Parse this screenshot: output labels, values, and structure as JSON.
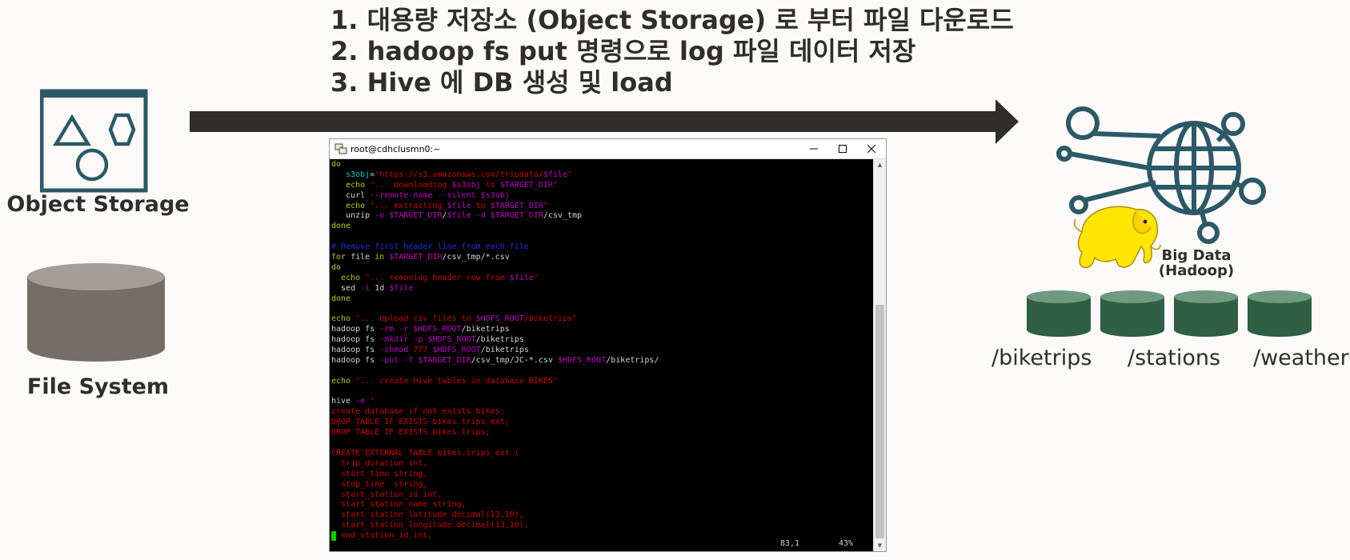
{
  "steps": [
    "1. 대용량 저장소 (Object Storage) 로 부터 파일 다운로드",
    "2. hadoop fs put 명령으로 log 파일 데이터 저장",
    "3. Hive 에 DB 생성 및 load"
  ],
  "left": {
    "object_storage_label": "Object Storage",
    "file_system_label": "File System"
  },
  "right": {
    "big_data_label_line1": "Big Data",
    "big_data_label_line2": "(Hadoop)",
    "paths": [
      "/biketrips",
      "/stations",
      "/weather"
    ]
  },
  "colors": {
    "text": "#312d2a",
    "arrow": "#312d2a",
    "teal": "#2c5967",
    "disk_green": "#2f5f44",
    "cylinder_gray": "#756d68",
    "hadoop_yellow": "#ffe600"
  },
  "icons": {
    "object_storage": "object-storage-icon",
    "file_system": "database-cylinder-icon",
    "big_data": "globe-network-icon",
    "hadoop": "hadoop-elephant-icon"
  },
  "terminal": {
    "title": "root@cdhclusmn0:~",
    "status_position": "83,1",
    "status_percent": "43%",
    "lines": [
      [
        {
          "c": "t-y",
          "t": "do"
        }
      ],
      [
        {
          "c": "t-w",
          "t": "   "
        },
        {
          "c": "t-c",
          "t": "s3obj"
        },
        {
          "c": "t-w",
          "t": "="
        },
        {
          "c": "t-r",
          "t": "\"https://s3.amazonaws.com/tripdata/"
        },
        {
          "c": "t-m",
          "t": "$file"
        },
        {
          "c": "t-r",
          "t": "\""
        }
      ],
      [
        {
          "c": "t-w",
          "t": "   "
        },
        {
          "c": "t-y",
          "t": "echo"
        },
        {
          "c": "t-w",
          "t": " "
        },
        {
          "c": "t-r",
          "t": "\"... downloading "
        },
        {
          "c": "t-m",
          "t": "$s3obj"
        },
        {
          "c": "t-r",
          "t": " to "
        },
        {
          "c": "t-m",
          "t": "$TARGET_DIR"
        },
        {
          "c": "t-r",
          "t": "\""
        }
      ],
      [
        {
          "c": "t-w",
          "t": "   curl "
        },
        {
          "c": "t-m",
          "t": "--remote-name --silent"
        },
        {
          "c": "t-w",
          "t": " "
        },
        {
          "c": "t-m",
          "t": "$s3obj"
        }
      ],
      [
        {
          "c": "t-w",
          "t": "   "
        },
        {
          "c": "t-y",
          "t": "echo"
        },
        {
          "c": "t-w",
          "t": " "
        },
        {
          "c": "t-r",
          "t": "\"... extracting "
        },
        {
          "c": "t-m",
          "t": "$file"
        },
        {
          "c": "t-r",
          "t": " to "
        },
        {
          "c": "t-m",
          "t": "$TARGET_DIR"
        },
        {
          "c": "t-r",
          "t": "\""
        }
      ],
      [
        {
          "c": "t-w",
          "t": "   unzip "
        },
        {
          "c": "t-m",
          "t": "-o"
        },
        {
          "c": "t-w",
          "t": " "
        },
        {
          "c": "t-m",
          "t": "$TARGET_DIR"
        },
        {
          "c": "t-w",
          "t": "/"
        },
        {
          "c": "t-m",
          "t": "$file"
        },
        {
          "c": "t-w",
          "t": " "
        },
        {
          "c": "t-m",
          "t": "-d"
        },
        {
          "c": "t-w",
          "t": " "
        },
        {
          "c": "t-m",
          "t": "$TARGET_DIR"
        },
        {
          "c": "t-w",
          "t": "/csv_tmp"
        }
      ],
      [
        {
          "c": "t-y",
          "t": "done"
        }
      ],
      [
        {
          "c": "t-w",
          "t": ""
        }
      ],
      [
        {
          "c": "t-b",
          "t": "# Remove first header line from each file"
        }
      ],
      [
        {
          "c": "t-y",
          "t": "for"
        },
        {
          "c": "t-w",
          "t": " file "
        },
        {
          "c": "t-y",
          "t": "in"
        },
        {
          "c": "t-w",
          "t": " "
        },
        {
          "c": "t-m",
          "t": "$TARGET_DIR"
        },
        {
          "c": "t-w",
          "t": "/csv_tmp/*.csv"
        }
      ],
      [
        {
          "c": "t-y",
          "t": "do"
        }
      ],
      [
        {
          "c": "t-w",
          "t": "  "
        },
        {
          "c": "t-y",
          "t": "echo"
        },
        {
          "c": "t-w",
          "t": " "
        },
        {
          "c": "t-r",
          "t": "\"... removing header row from "
        },
        {
          "c": "t-m",
          "t": "$file"
        },
        {
          "c": "t-r",
          "t": "\""
        }
      ],
      [
        {
          "c": "t-w",
          "t": "  sed "
        },
        {
          "c": "t-m",
          "t": "-i"
        },
        {
          "c": "t-w",
          "t": " 1d "
        },
        {
          "c": "t-m",
          "t": "$file"
        }
      ],
      [
        {
          "c": "t-y",
          "t": "done"
        }
      ],
      [
        {
          "c": "t-w",
          "t": ""
        }
      ],
      [
        {
          "c": "t-y",
          "t": "echo"
        },
        {
          "c": "t-w",
          "t": " "
        },
        {
          "c": "t-r",
          "t": "\"... Upload csv files to "
        },
        {
          "c": "t-m",
          "t": "$HDFS_ROOT"
        },
        {
          "c": "t-r",
          "t": "/biketrips\""
        }
      ],
      [
        {
          "c": "t-w",
          "t": "hadoop fs "
        },
        {
          "c": "t-m",
          "t": "-rm -r"
        },
        {
          "c": "t-w",
          "t": " "
        },
        {
          "c": "t-m",
          "t": "$HDFS_ROOT"
        },
        {
          "c": "t-w",
          "t": "/biketrips"
        }
      ],
      [
        {
          "c": "t-w",
          "t": "hadoop fs "
        },
        {
          "c": "t-m",
          "t": "-mkdir -p"
        },
        {
          "c": "t-w",
          "t": " "
        },
        {
          "c": "t-m",
          "t": "$HDFS_ROOT"
        },
        {
          "c": "t-w",
          "t": "/biketrips"
        }
      ],
      [
        {
          "c": "t-w",
          "t": "hadoop fs "
        },
        {
          "c": "t-m",
          "t": "-chmod"
        },
        {
          "c": "t-w",
          "t": " "
        },
        {
          "c": "t-r",
          "t": "777"
        },
        {
          "c": "t-w",
          "t": " "
        },
        {
          "c": "t-m",
          "t": "$HDFS_ROOT"
        },
        {
          "c": "t-w",
          "t": "/biketrips"
        }
      ],
      [
        {
          "c": "t-w",
          "t": "hadoop fs "
        },
        {
          "c": "t-m",
          "t": "-put -f"
        },
        {
          "c": "t-w",
          "t": " "
        },
        {
          "c": "t-m",
          "t": "$TARGET_DIR"
        },
        {
          "c": "t-w",
          "t": "/csv_tmp/JC-*.csv "
        },
        {
          "c": "t-m",
          "t": "$HDFS_ROOT"
        },
        {
          "c": "t-w",
          "t": "/biketrips/"
        }
      ],
      [
        {
          "c": "t-w",
          "t": ""
        }
      ],
      [
        {
          "c": "t-y",
          "t": "echo"
        },
        {
          "c": "t-w",
          "t": " "
        },
        {
          "c": "t-r",
          "t": "\"... create Hive tables in database BIKES\""
        }
      ],
      [
        {
          "c": "t-w",
          "t": ""
        }
      ],
      [
        {
          "c": "t-w",
          "t": "hive "
        },
        {
          "c": "t-m",
          "t": "-e"
        },
        {
          "c": "t-w",
          "t": " "
        },
        {
          "c": "t-r",
          "t": "\""
        }
      ],
      [
        {
          "c": "t-r",
          "t": "create database if not exists bikes;"
        }
      ],
      [
        {
          "c": "t-r",
          "t": "DROP TABLE IF EXISTS bikes.trips_ext;"
        }
      ],
      [
        {
          "c": "t-r",
          "t": "DROP TABLE IF EXISTS bikes.trips;"
        }
      ],
      [
        {
          "c": "t-w",
          "t": ""
        }
      ],
      [
        {
          "c": "t-r",
          "t": "CREATE EXTERNAL TABLE bikes.trips_ext ("
        }
      ],
      [
        {
          "c": "t-r",
          "t": "  trip_duration int,"
        }
      ],
      [
        {
          "c": "t-r",
          "t": "  start_time string,"
        }
      ],
      [
        {
          "c": "t-r",
          "t": "  stop_time  string,"
        }
      ],
      [
        {
          "c": "t-r",
          "t": "  start_station_id int,"
        }
      ],
      [
        {
          "c": "t-r",
          "t": "  start_station_name string,"
        }
      ],
      [
        {
          "c": "t-r",
          "t": "  start_station_latitude decimal(13,10),"
        }
      ],
      [
        {
          "c": "t-r",
          "t": "  start_station_longitude decimal(13,10),"
        }
      ],
      [
        {
          "c": "t-r",
          "t": "  end_station_id int,"
        }
      ]
    ]
  }
}
